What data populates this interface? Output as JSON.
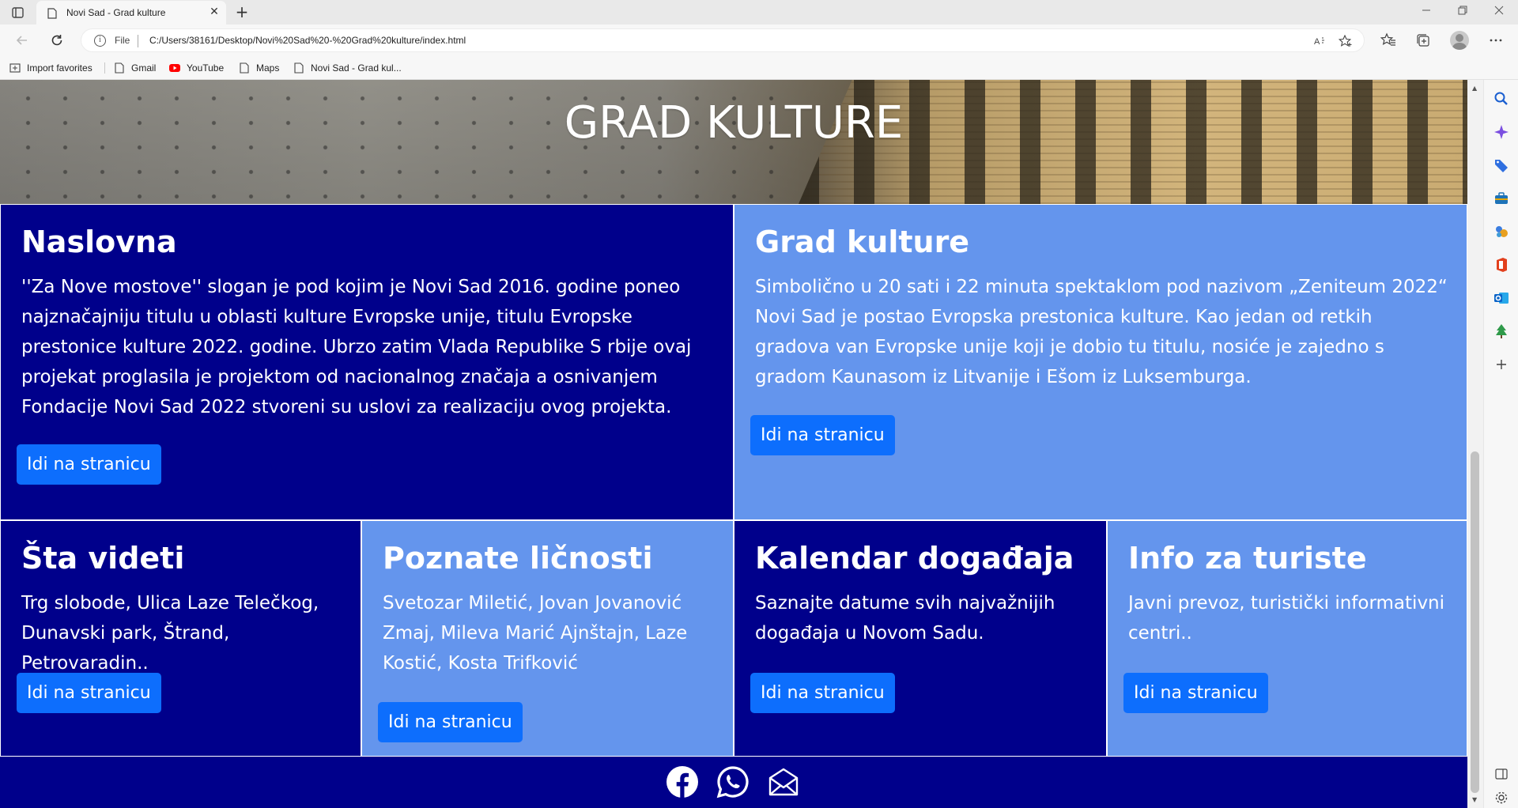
{
  "browser": {
    "tab_title": "Novi Sad - Grad kulture",
    "tab_close": "✕",
    "new_tab": "+",
    "address_protocol": "File",
    "address_url": "C:/Users/38161/Desktop/Novi%20Sad%20-%20Grad%20kulture/index.html",
    "bookmarks": [
      {
        "label": "Import favorites",
        "icon": "import-icon"
      },
      {
        "label": "Gmail",
        "icon": "page-icon"
      },
      {
        "label": "YouTube",
        "icon": "youtube-icon"
      },
      {
        "label": "Maps",
        "icon": "page-icon"
      },
      {
        "label": "Novi Sad - Grad kul...",
        "icon": "page-icon"
      }
    ]
  },
  "hero": {
    "title": "GRAD KULTURE"
  },
  "cards": [
    {
      "title": "Naslovna",
      "text": "''Za Nove mostove'' slogan je pod kojim je Novi Sad 2016. godine poneo najznačajniju titulu u oblasti kulture Evropske unije, titulu Evropske prestonice kulture 2022. godine. Ubrzo zatim Vlada Republike S rbije ovaj projekat proglasila je projektom od nacionalnog značaja a osnivanjem Fondacije Novi Sad 2022 stvoreni su uslovi za realizaciju ovog projekta.",
      "button": "Idi na stranicu",
      "style": "dark"
    },
    {
      "title": "Grad kulture",
      "text": "Simbolično u 20 sati i 22 minuta spektaklom pod nazivom „Zeniteum 2022“ Novi Sad je postao Evropska prestonica kulture. Kao jedan od retkih gradova van Evropske unije koji je dobio tu titulu, nosiće je zajedno s gradom Kaunasom iz Litvanije i Ešom iz Luksemburga.",
      "button": "Idi na stranicu",
      "style": "light"
    },
    {
      "title": "Šta videti",
      "text": "Trg slobode, Ulica Laze Telečkog, Dunavski park, Štrand, Petrovaradin..",
      "button": "Idi na stranicu",
      "style": "dark"
    },
    {
      "title": "Poznate ličnosti",
      "text": "Svetozar Miletić, Jovan Jovanović Zmaj, Mileva Marić Ajnštajn, Laze Kostić, Kosta Trifković",
      "button": "Idi na stranicu",
      "style": "light"
    },
    {
      "title": "Kalendar događaja",
      "text": "Saznajte datume svih najvažnijih događaja u Novom Sadu.",
      "button": "Idi na stranicu",
      "style": "dark"
    },
    {
      "title": "Info za turiste",
      "text": "Javni prevoz, turistički informativni centri..",
      "button": "Idi na stranicu",
      "style": "light"
    }
  ],
  "footer": {
    "icons": [
      "facebook-icon",
      "whatsapp-icon",
      "mail-icon"
    ]
  },
  "colors": {
    "dark_card": "#00008b",
    "light_card": "#6495ed",
    "button": "#0d6efd"
  }
}
